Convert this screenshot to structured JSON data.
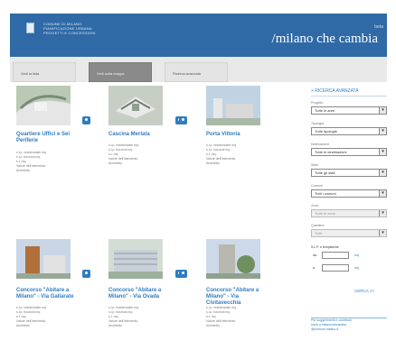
{
  "header": {
    "org_lines": [
      "COMUNE DI MILANO",
      "PIANIFICAZIONE URBANA",
      "PROGETTI E CONCESSIONI"
    ],
    "tagline": "/milano che cambia",
    "tagline_sup": "beta",
    "brand_color": "#2f6aa6"
  },
  "tabs": [
    {
      "label": "Vedi la lista",
      "active": false
    },
    {
      "label": "Vedi sulla mappa",
      "active": true
    },
    {
      "label": "Ricerca avanzata",
      "active": false
    }
  ],
  "cards": [
    {
      "title": "Quartiere Uffici e Sei Periferie",
      "lines": [
        "s.l.p. residenziale mq",
        "s.l.p. funzioni mq",
        "s.t. mq",
        "Valore dell'intervento",
        "Architetto"
      ]
    },
    {
      "title": "Cascina Merlata",
      "lines": [
        "s.l.p. residenziale mq",
        "s.l.p. funzioni mq",
        "s.t. mq",
        "Valore dell'intervento",
        "Architetto"
      ]
    },
    {
      "title": "Porta Vittoria",
      "lines": [
        "s.l.p. residenziale mq",
        "s.l.p. funzioni mq",
        "s.t. mq",
        "Valore dell'intervento",
        "Architetto"
      ]
    },
    {
      "title": "Concorso \"Abitare a Milano\" - Via Gallarate",
      "lines": [
        "s.l.p. residenziale mq",
        "s.l.p. funzioni mq",
        "s.t. mq",
        "Valore dell'intervento",
        "Architetto"
      ]
    },
    {
      "title": "Concorso \"Abitare a Milano\" - Via Ovada",
      "lines": [
        "s.l.p. residenziale mq",
        "s.l.p. funzioni mq",
        "s.t. mq",
        "Valore dell'intervento",
        "Architetto"
      ]
    },
    {
      "title": "Concorso \"Abitare a Milano\" - Via Civitavecchia",
      "lines": [
        "s.l.p. residenziale mq",
        "s.l.p. funzioni mq",
        "s.t. mq",
        "Valore dell'intervento",
        "Architetto"
      ]
    }
  ],
  "sidebar": {
    "title": "> RICERCA AVANZATA",
    "filters": [
      {
        "label": "Progetto",
        "value": "Tutte le aree",
        "disabled": false
      },
      {
        "label": "Tipologia",
        "value": "Tutte tipologie",
        "disabled": false
      },
      {
        "label": "Destinazione",
        "value": "Tutte le destinazioni",
        "disabled": false
      },
      {
        "label": "Stato",
        "value": "Tutte gli stati",
        "disabled": false
      },
      {
        "label": "Comune",
        "value": "Tutti i comuni",
        "disabled": false
      },
      {
        "label": "Zona",
        "value": "Tutte le zone",
        "disabled": true
      },
      {
        "label": "Quartiere",
        "value": "Tutti",
        "disabled": true
      }
    ],
    "range_title": "S.L.P. e tempistiche",
    "range_from": "da",
    "range_to": "a",
    "range_unit": "mq",
    "search_label": "CERCA >>",
    "promo_lines": [
      "Per suggerimenti e contributi",
      "scrivi a milanochecambia",
      "@comune.milano.it"
    ]
  }
}
